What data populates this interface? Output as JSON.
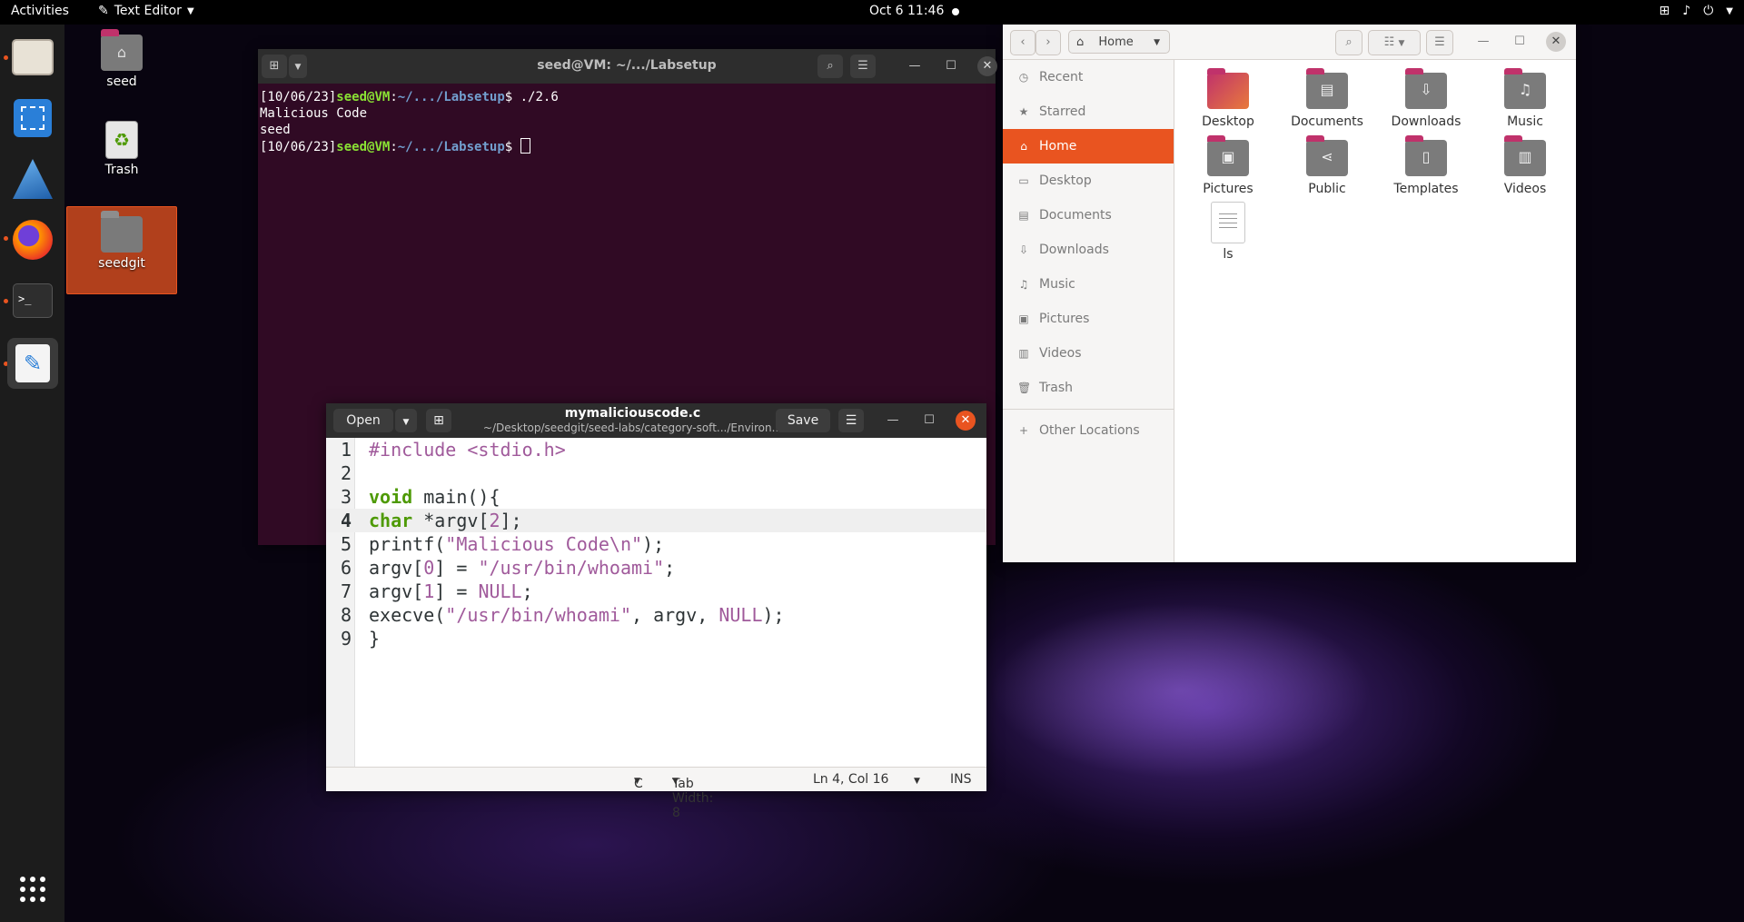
{
  "topbar": {
    "activities": "Activities",
    "app_name": "Text Editor",
    "clock": "Oct 6  11:46"
  },
  "desktop": {
    "icons": [
      {
        "label": "seed"
      },
      {
        "label": "Trash"
      },
      {
        "label": "seedgit"
      }
    ]
  },
  "terminal": {
    "title": "seed@VM: ~/.../Labsetup",
    "lines": [
      {
        "pre": "[10/06/23]",
        "user": "seed@VM",
        "sep": ":",
        "path": "~/.../Labsetup",
        "cmd": "$ ./2.6"
      },
      {
        "text": "Malicious Code"
      },
      {
        "text": "seed"
      },
      {
        "pre": "[10/06/23]",
        "user": "seed@VM",
        "sep": ":",
        "path": "~/.../Labsetup",
        "cmd": "$ "
      }
    ]
  },
  "files": {
    "location": "Home",
    "sidebar": [
      {
        "label": "Recent",
        "icon": "clock-icon"
      },
      {
        "label": "Starred",
        "icon": "star-icon"
      },
      {
        "label": "Home",
        "icon": "home-icon",
        "active": true
      },
      {
        "label": "Desktop",
        "icon": "desktop-icon"
      },
      {
        "label": "Documents",
        "icon": "documents-icon"
      },
      {
        "label": "Downloads",
        "icon": "download-icon"
      },
      {
        "label": "Music",
        "icon": "music-icon"
      },
      {
        "label": "Pictures",
        "icon": "pictures-icon"
      },
      {
        "label": "Videos",
        "icon": "videos-icon"
      },
      {
        "label": "Trash",
        "icon": "trash-icon"
      },
      {
        "label": "Other Locations",
        "icon": "plus-icon"
      }
    ],
    "items": [
      {
        "label": "Desktop"
      },
      {
        "label": "Documents"
      },
      {
        "label": "Downloads"
      },
      {
        "label": "Music"
      },
      {
        "label": "Pictures"
      },
      {
        "label": "Public"
      },
      {
        "label": "Templates"
      },
      {
        "label": "Videos"
      },
      {
        "label": "ls"
      }
    ]
  },
  "editor": {
    "open_label": "Open",
    "save_label": "Save",
    "filename": "mymaliciouscode.c",
    "path": "~/Desktop/seedgit/seed-labs/category-soft.../Environ...",
    "status": {
      "language": "C",
      "tab_width": "Tab Width: 8",
      "position": "Ln 4, Col 16",
      "mode": "INS"
    },
    "line_numbers": [
      "1",
      "2",
      "3",
      "4",
      "5",
      "6",
      "7",
      "8",
      "9"
    ],
    "code": {
      "l1_a": "#include ",
      "l1_b": "<stdio.h>",
      "l3_a": "void",
      "l3_b": " main(){",
      "l4_a": "char",
      "l4_b": " *argv[",
      "l4_c": "2",
      "l4_d": "];",
      "l5_a": "printf(",
      "l5_b": "\"Malicious Code\\n\"",
      "l5_c": ");",
      "l6_a": "argv[",
      "l6_b": "0",
      "l6_c": "] = ",
      "l6_d": "\"/usr/bin/whoami\"",
      "l6_e": ";",
      "l7_a": "argv[",
      "l7_b": "1",
      "l7_c": "] = ",
      "l7_d": "NULL",
      "l7_e": ";",
      "l8_a": "execve(",
      "l8_b": "\"/usr/bin/whoami\"",
      "l8_c": ", argv, ",
      "l8_d": "NULL",
      "l8_e": ");",
      "l9_a": "}"
    }
  }
}
